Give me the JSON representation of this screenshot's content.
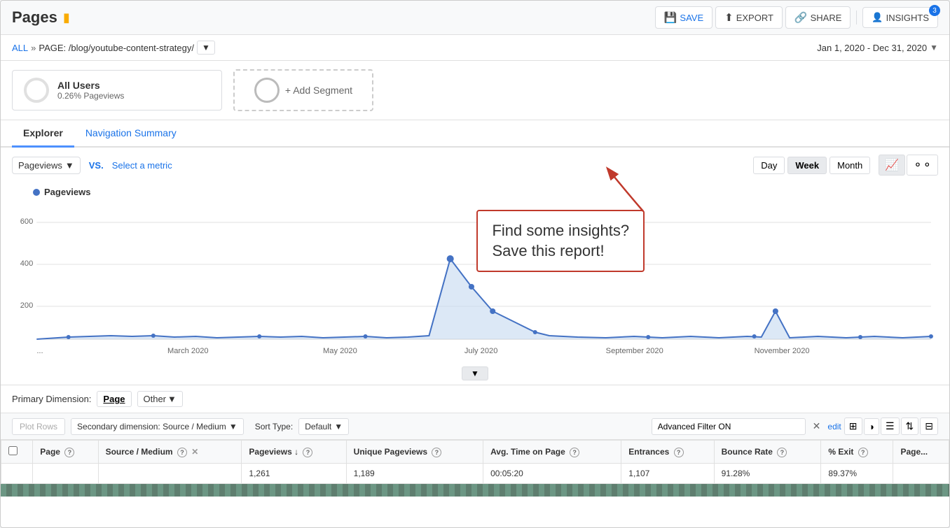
{
  "header": {
    "title": "Pages",
    "verified_icon": "✓",
    "actions": {
      "save": "SAVE",
      "export": "EXPORT",
      "share": "SHARE",
      "insights": "INSIGHTS",
      "insights_badge": "3"
    }
  },
  "breadcrumb": {
    "all_label": "ALL",
    "page_label": "PAGE: /blog/youtube-content-strategy/",
    "separator": "»"
  },
  "date_range": {
    "label": "Jan 1, 2020 - Dec 31, 2020",
    "arrow": "▼"
  },
  "segment": {
    "name": "All Users",
    "sub": "0.26% Pageviews",
    "add_label": "+ Add Segment"
  },
  "tabs": {
    "explorer": "Explorer",
    "nav_summary": "Navigation Summary"
  },
  "chart_controls": {
    "metric": "Pageviews",
    "vs_label": "VS.",
    "select_metric": "Select a metric",
    "day_btn": "Day",
    "week_btn": "Week",
    "month_btn": "Month"
  },
  "chart": {
    "legend": "Pageviews",
    "y_labels": [
      "600",
      "400",
      "200"
    ],
    "x_labels": [
      "...",
      "March 2020",
      "May 2020",
      "July 2020",
      "September 2020",
      "November 2020"
    ]
  },
  "callout": {
    "line1": "Find some insights?",
    "line2": "Save this report!"
  },
  "dimension_row": {
    "primary_label": "Primary Dimension:",
    "page_btn": "Page",
    "other_btn": "Other",
    "dropdown_arrow": "▼"
  },
  "filter_row": {
    "plot_rows_btn": "Plot Rows",
    "secondary_dim_label": "Secondary dimension: Source / Medium",
    "sort_label": "Sort Type:",
    "sort_value": "Default",
    "filter_value": "Advanced Filter ON",
    "edit_label": "edit"
  },
  "table": {
    "columns": [
      {
        "label": "Page",
        "help": true
      },
      {
        "label": "Source / Medium",
        "help": true,
        "closeable": true
      },
      {
        "label": "Pageviews",
        "help": true,
        "sort": true
      },
      {
        "label": "Unique Pageviews",
        "help": true
      },
      {
        "label": "Avg. Time on Page",
        "help": true
      },
      {
        "label": "Entrances",
        "help": true
      },
      {
        "label": "Bounce Rate",
        "help": true
      },
      {
        "label": "% Exit",
        "help": true
      },
      {
        "label": "Page..."
      }
    ],
    "footer": {
      "pageviews": "1,261",
      "unique": "1,189",
      "avg_time": "00:05:20",
      "entrances": "1,107",
      "bounce_rate": "91.28%",
      "exit_pct": "89.37%"
    }
  },
  "colors": {
    "blue_link": "#1a73e8",
    "chart_line": "#4472c4",
    "chart_fill": "#c5d8f0",
    "callout_border": "#c0392b",
    "active_tab_border": "#4d90fe"
  }
}
